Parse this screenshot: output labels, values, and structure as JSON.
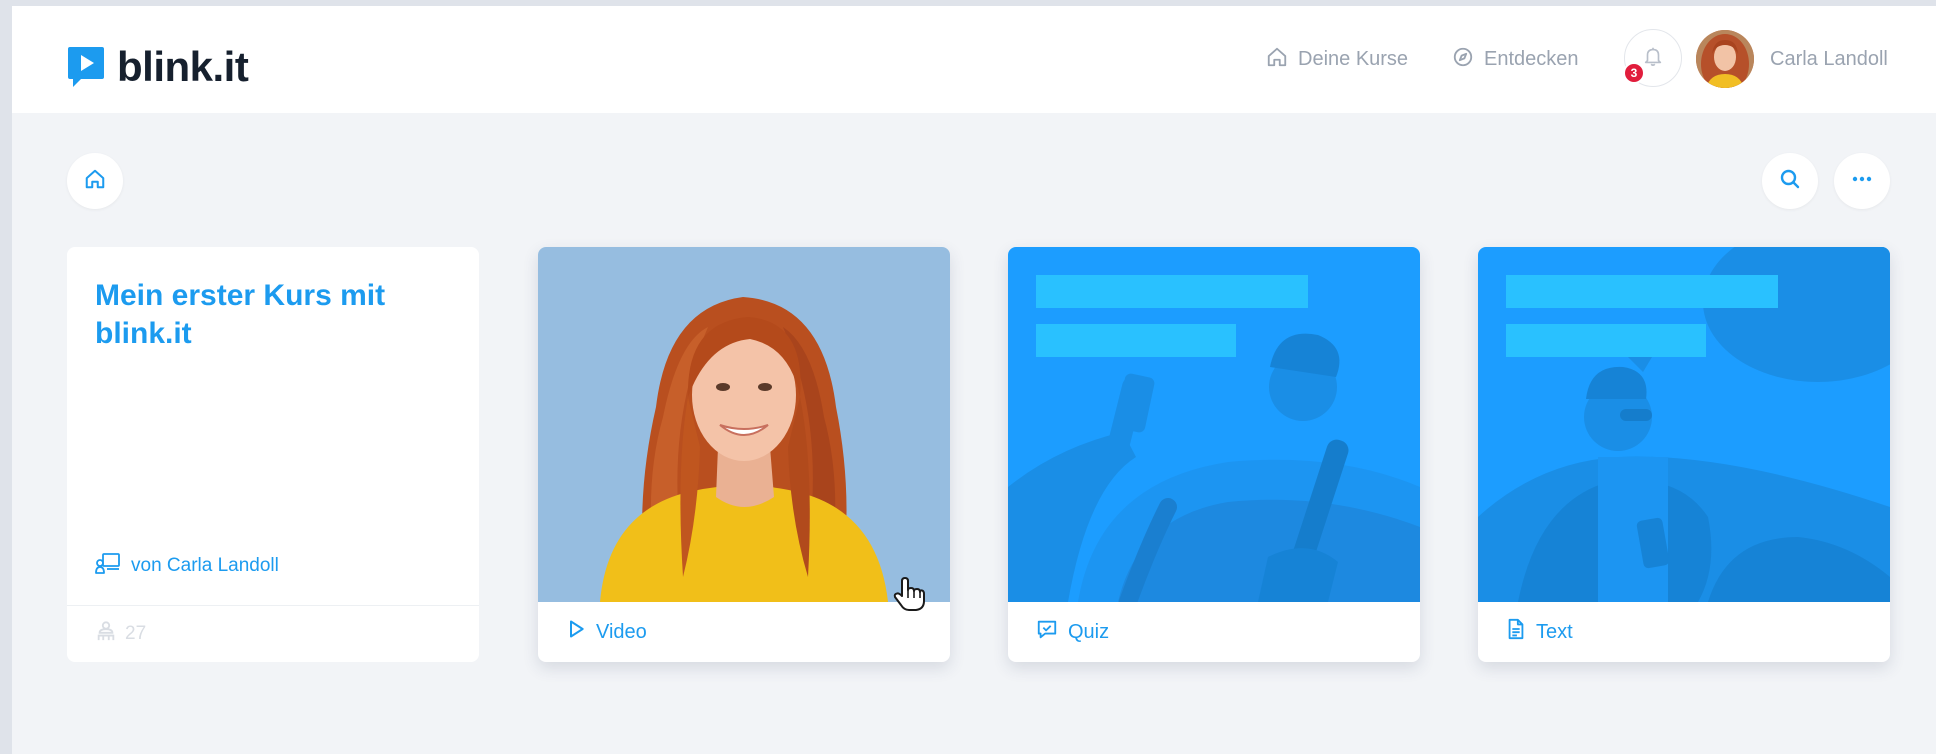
{
  "app": {
    "brand": "blink.it"
  },
  "nav": {
    "courses_label": "Deine Kurse",
    "discover_label": "Entdecken"
  },
  "notifications": {
    "count": "3"
  },
  "user": {
    "name": "Carla Landoll"
  },
  "course": {
    "title": "Mein erster Kurs mit blink.it",
    "author": "von Carla Landoll",
    "count": "27"
  },
  "cards": [
    {
      "type_label": "Video",
      "icon": "play-icon"
    },
    {
      "type_label": "Quiz",
      "icon": "chat-check-icon"
    },
    {
      "type_label": "Text",
      "icon": "document-icon"
    }
  ],
  "colors": {
    "accent": "#1c9bef",
    "tile_blue": "#1c9dff",
    "badge": "#e11d3c",
    "muted_text": "#9aa3b0"
  }
}
